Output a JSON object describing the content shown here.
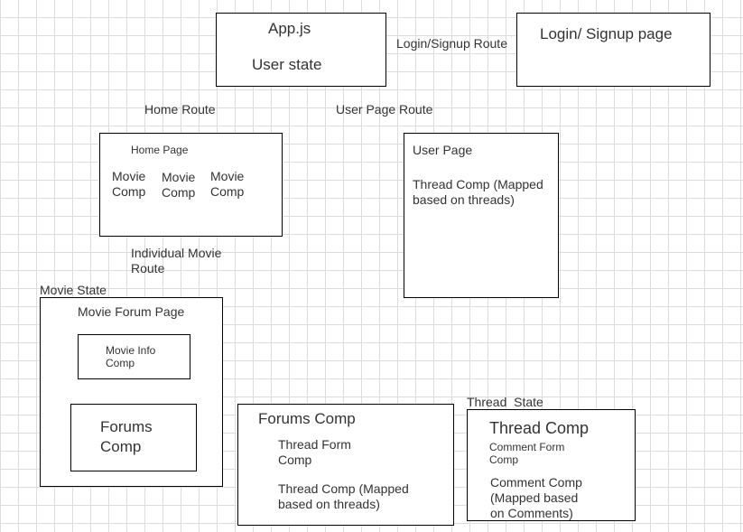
{
  "nodes": {
    "app": {
      "title": "App.js",
      "state": "User state"
    },
    "login": {
      "title": "Login/ Signup page"
    },
    "home": {
      "title": "Home Page",
      "movie_comps": [
        "Movie\nComp",
        "Movie\nComp",
        "Movie\nComp"
      ]
    },
    "user_page": {
      "title": "User Page",
      "thread_comp": "Thread Comp (Mapped\nbased on threads)"
    },
    "movie_forum": {
      "title": "Movie Forum Page",
      "movie_info": "Movie Info\nComp",
      "forums_comp": "Forums\nComp"
    },
    "forums_comp": {
      "title": "Forums Comp",
      "thread_form": "Thread Form\nComp",
      "thread_comp": "Thread Comp (Mapped\nbased on threads)"
    },
    "thread_comp": {
      "title": "Thread Comp",
      "comment_form": "Comment Form\nComp",
      "comment_comp": "Comment Comp\n(Mapped based\non Comments)"
    }
  },
  "edges": {
    "login_route": "Login/Signup Route",
    "home_route": "Home Route",
    "user_page_route": "User Page Route",
    "movie_route": "Individual Movie\nRoute",
    "movie_state": "Movie State",
    "thread_state": "Thread  State"
  }
}
